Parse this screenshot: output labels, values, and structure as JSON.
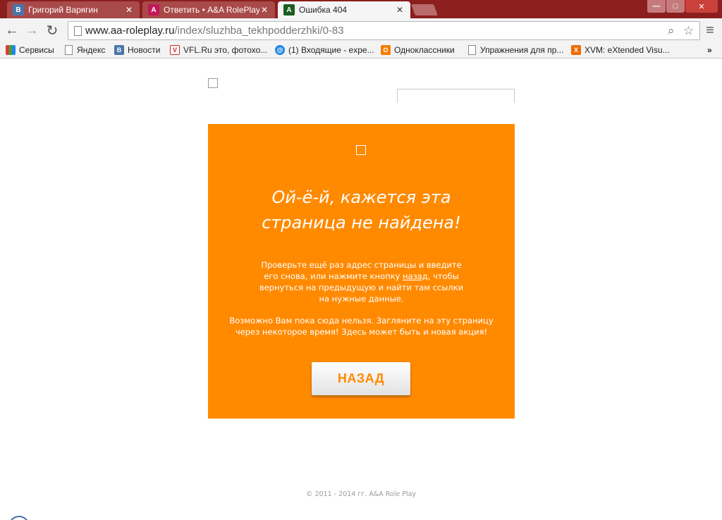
{
  "browser": {
    "tabs": [
      {
        "title": "Григорий Варягин",
        "favicon": "vk-icon",
        "favicon_color": "#4a76a8",
        "active": false
      },
      {
        "title": "Ответить • A&A RolePlay",
        "favicon": "aa-roleplay-icon",
        "favicon_color": "#c2185b",
        "active": false
      },
      {
        "title": "Ошибка 404",
        "favicon": "a-letter-icon",
        "favicon_color": "#1b5e20",
        "active": true
      }
    ],
    "url": {
      "domain": "www.aa-roleplay.ru",
      "path": "/index/sluzhba_tekhpodderzhki/0-83"
    },
    "window_controls": [
      "—",
      "□",
      "✕"
    ]
  },
  "bookmarks": [
    {
      "label": "Сервисы",
      "icon": "apps-grid-icon"
    },
    {
      "label": "Яндекс",
      "icon": "page-icon"
    },
    {
      "label": "Новости",
      "icon": "vk-icon"
    },
    {
      "label": "VFL.Ru это, фотохо...",
      "icon": "vfl-icon"
    },
    {
      "label": "(1) Входящие - expe...",
      "icon": "mail-at-icon"
    },
    {
      "label": "Одноклассники",
      "icon": "odnoklassniki-icon"
    },
    {
      "label": "Упражнения для пр...",
      "icon": "page-icon"
    },
    {
      "label": "XVM: eXtended Visu...",
      "icon": "xvm-icon"
    }
  ],
  "bookmarks_overflow": "»",
  "error_page": {
    "headline_line1": "Ой-ё-й, кажется эта",
    "headline_line2": "страница не найдена!",
    "para1_before": "Проверьте ещё раз адрес страницы и введите его снова, или нажмите кнопку ",
    "para1_link": "назад",
    "para1_after": ", чтобы вернуться на предыдущую и найти там ссылки на нужные данные.",
    "para2": "Возможно Вам пока сюда нельзя. Загляните на эту страницу через некоторое время! Здесь может быть и новая акция!",
    "back_button": "НАЗАД",
    "accent_color": "#ff8a00"
  },
  "footer": "© 2011 - 2014 гг. A&A Role Play"
}
